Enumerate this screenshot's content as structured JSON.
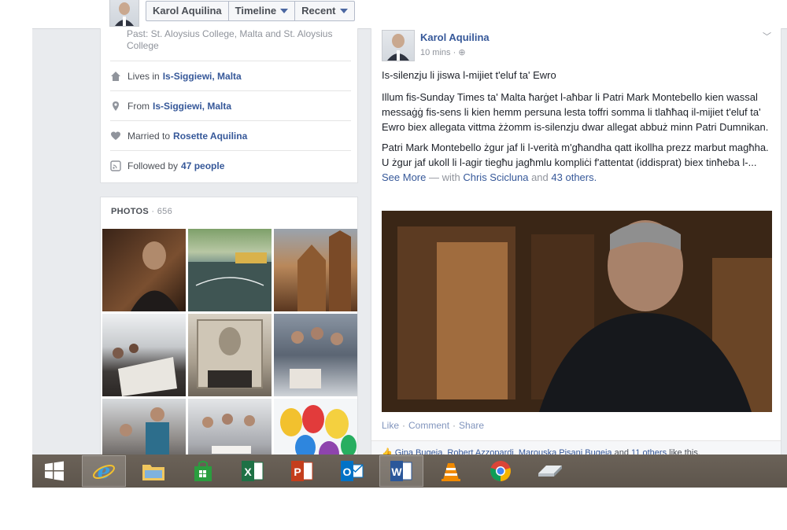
{
  "header": {
    "name": "Karol Aquilina",
    "timeline_label": "Timeline",
    "recent_label": "Recent"
  },
  "about": {
    "education_text": "Past: St. Aloysius College, Malta and St. Aloysius College",
    "lives_prefix": "Lives in",
    "lives_place": "Is-Siggiewi, Malta",
    "from_prefix": "From",
    "from_place": "Is-Siggiewi, Malta",
    "married_prefix": "Married to",
    "married_name": "Rosette Aquilina",
    "followed_prefix": "Followed by",
    "followed_count": "47 people"
  },
  "photos": {
    "header": "PHOTOS",
    "count": "· 656"
  },
  "post": {
    "author": "Karol Aquilina",
    "time": "10 mins ·",
    "title": "Is-silenzju li jiswa l-mijiet t'eluf ta' Ewro",
    "paragraph1": "Illum fis-Sunday Times ta' Malta ħarġet l-aħbar li Patri Mark Montebello kien wassal messaġġ fis-sens li kien hemm persuna lesta toffri somma li tlaħħaq il-mijiet t'eluf ta' Ewro biex allegata vittma żżomm is-silenzju dwar allegat abbuż minn Patri Dumnikan.",
    "paragraph2": "Patri Mark Montebello żgur jaf li l-verità m'għandha qatt ikollha prezz marbut magħha. U żgur jaf ukoll li l-agir tiegħu jagħmlu kompliċi f'attentat (iddisprat) biex tinħeba l-...",
    "see_more": "See More",
    "with_text": "— with",
    "tag1": "Chris Scicluna",
    "and_text": "and",
    "tag2": "43 others.",
    "like": "Like",
    "comment": "Comment",
    "share": "Share",
    "likers": "Gina Bugeja, Robert Azzopardi, Marouska Pisani Bugeja",
    "likers_and": "and",
    "likers_more": "11 others",
    "likers_suffix": "like this."
  },
  "taskbar": {
    "items": [
      "windows-start",
      "internet-explorer",
      "file-explorer",
      "windows-store",
      "excel",
      "powerpoint",
      "outlook",
      "word",
      "vlc",
      "chrome",
      "app"
    ]
  }
}
